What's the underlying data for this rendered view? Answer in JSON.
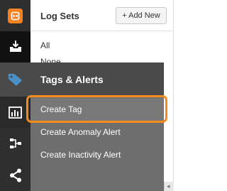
{
  "panel": {
    "title": "Log Sets",
    "add_button": "+ Add New",
    "items": [
      "All",
      "None"
    ]
  },
  "flyout": {
    "title": "Tags & Alerts",
    "items": [
      "Create Tag",
      "Create Anomaly Alert",
      "Create Inactivity Alert"
    ]
  },
  "rail": {
    "icons": [
      "logo-icon",
      "inbox-icon",
      "tag-icon",
      "bar-chart-icon",
      "flow-icon",
      "share-icon"
    ]
  },
  "colors": {
    "accent": "#f58220",
    "rail_bg": "#2f2f2f",
    "flyout_header": "#4a4a4a",
    "flyout_body": "#6e6e6e",
    "highlight": "#f58b1f"
  }
}
